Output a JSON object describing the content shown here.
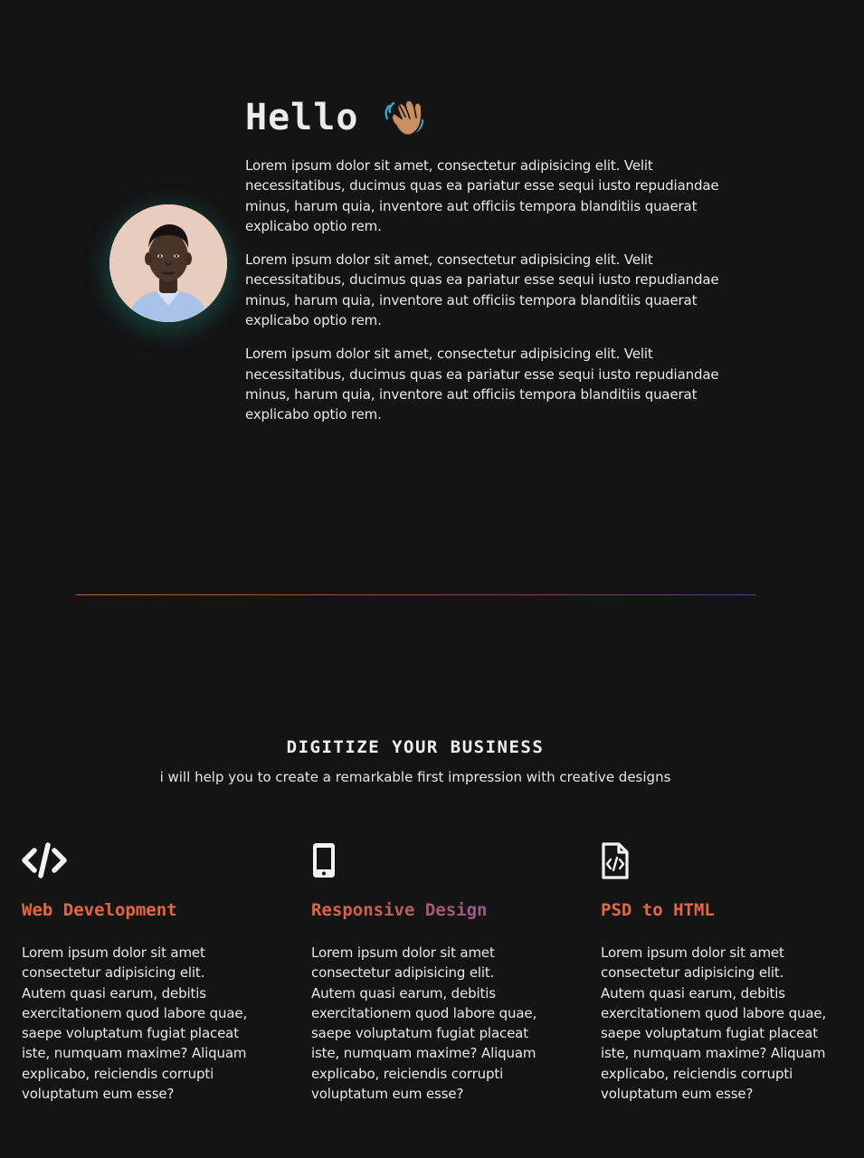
{
  "intro": {
    "heading": "Hello",
    "wave_icon": "waving-hand-emoji",
    "paragraphs": [
      "Lorem ipsum dolor sit amet, consectetur adipisicing elit. Velit necessitatibus, ducimus quas ea pariatur esse sequi iusto repudiandae minus, harum quia, inventore aut officiis tempora blanditiis quaerat explicabo optio rem.",
      "Lorem ipsum dolor sit amet, consectetur adipisicing elit. Velit necessitatibus, ducimus quas ea pariatur esse sequi iusto repudiandae minus, harum quia, inventore aut officiis tempora blanditiis quaerat explicabo optio rem.",
      "Lorem ipsum dolor sit amet, consectetur adipisicing elit. Velit necessitatibus, ducimus quas ea pariatur esse sequi iusto repudiandae minus, harum quia, inventore aut officiis tempora blanditiis quaerat explicabo optio rem."
    ]
  },
  "services": {
    "title": "DIGITIZE YOUR BUSINESS",
    "subtitle": "i will help you to create a remarkable first impression with creative designs",
    "items": [
      {
        "icon": "code-icon",
        "title": "Web Development",
        "text": "Lorem ipsum dolor sit amet consectetur adipisicing elit. Autem quasi earum, debitis exercitationem quod labore quae, saepe voluptatum fugiat placeat iste, numquam maxime? Aliquam explicabo, reiciendis corrupti voluptatum eum esse?"
      },
      {
        "icon": "mobile-phone-icon",
        "title": "Responsive Design",
        "text": "Lorem ipsum dolor sit amet consectetur adipisicing elit. Autem quasi earum, debitis exercitationem quod labore quae, saepe voluptatum fugiat placeat iste, numquam maxime? Aliquam explicabo, reiciendis corrupti voluptatum eum esse?"
      },
      {
        "icon": "code-file-icon",
        "title": "PSD to HTML",
        "text": "Lorem ipsum dolor sit amet consectetur adipisicing elit. Autem quasi earum, debitis exercitationem quod labore quae, saepe voluptatum fugiat placeat iste, numquam maxime? Aliquam explicabo, reiciendis corrupti voluptatum eum esse?"
      }
    ]
  },
  "colors": {
    "background": "#141414",
    "accent_orange": "#e3683b",
    "accent_purple": "#8a5aa8",
    "avatar_glow": "#186e62"
  }
}
